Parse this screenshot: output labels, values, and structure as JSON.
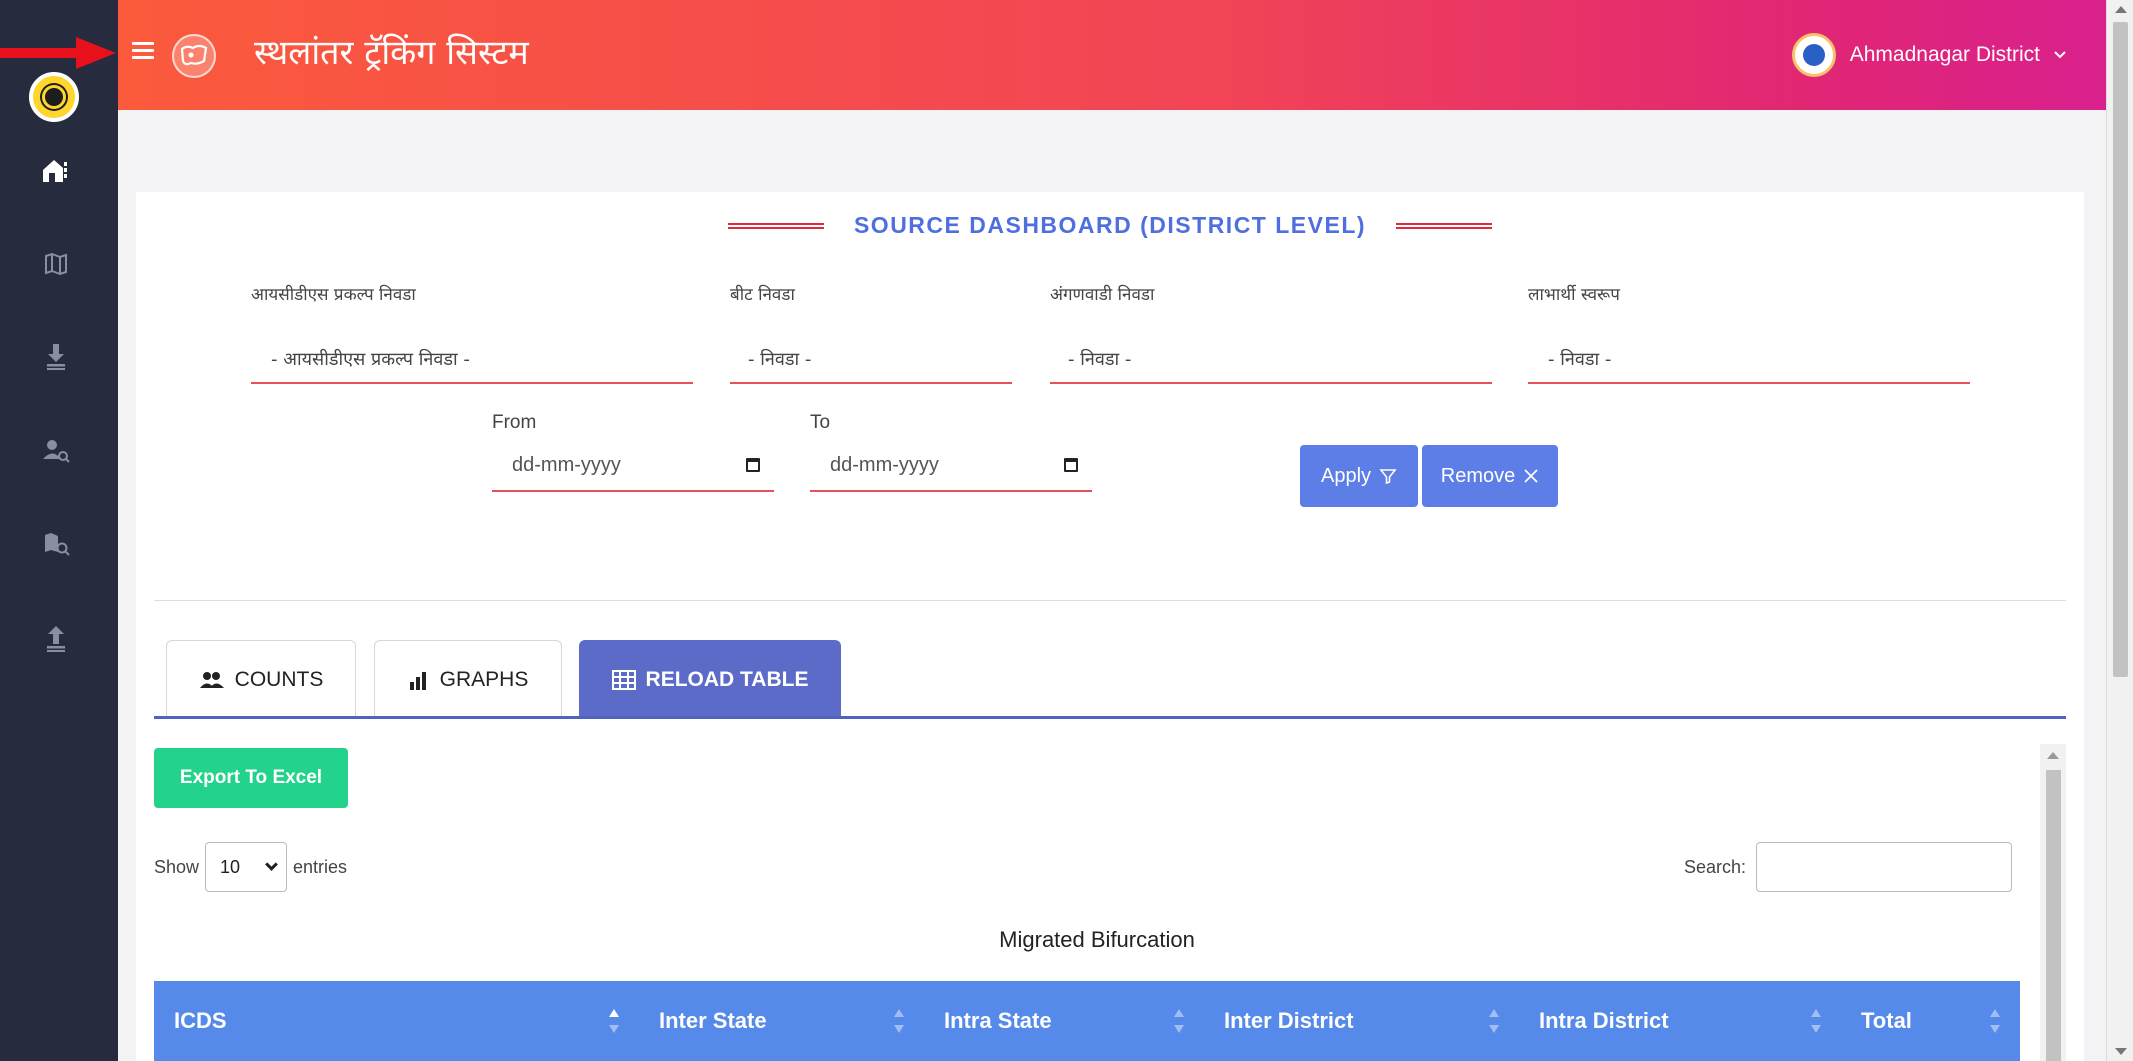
{
  "header": {
    "title": "स्थलांतर ट्रॅकिंग सिस्टम",
    "user_label": "Ahmadnagar District",
    "user_dropdown_icon": "chevron-down-icon"
  },
  "colors": {
    "header_start": "#fb5a3c",
    "header_end": "#d9208d",
    "sidebar": "#262b3d",
    "accent": "#5c7ee6",
    "success": "#23d38c",
    "table_header": "#5589ea",
    "underline": "#e3515d"
  },
  "sidebar": {
    "items": [
      {
        "icon": "home-icon"
      },
      {
        "icon": "map-icon"
      },
      {
        "icon": "download-icon"
      },
      {
        "icon": "user-search-icon"
      },
      {
        "icon": "map-search-icon"
      },
      {
        "icon": "upload-icon"
      }
    ]
  },
  "dashboard": {
    "title": "SOURCE DASHBOARD (DISTRICT LEVEL)",
    "filters": [
      {
        "label": "आयसीडीएस प्रकल्प निवडा",
        "value": "- आयसीडीएस प्रकल्प निवडा -"
      },
      {
        "label": "बीट निवडा",
        "value": "- निवडा -"
      },
      {
        "label": "अंगणवाडी निवडा",
        "value": "- निवडा -"
      },
      {
        "label": "लाभार्थी स्वरूप",
        "value": "- निवडा -"
      }
    ],
    "from_label": "From",
    "to_label": "To",
    "from_placeholder": "dd-mm-yyyy",
    "to_placeholder": "dd-mm-yyyy",
    "apply_label": "Apply",
    "remove_label": "Remove"
  },
  "tabs": [
    {
      "label": "COUNTS",
      "icon": "users-icon",
      "active": false
    },
    {
      "label": "GRAPHS",
      "icon": "bar-chart-icon",
      "active": false
    },
    {
      "label": "RELOAD TABLE",
      "icon": "table-icon",
      "active": true
    }
  ],
  "table": {
    "export_label": "Export To Excel",
    "show_label": "Show",
    "entries_value": "10",
    "entries_label": "entries",
    "search_label": "Search:",
    "search_value": "",
    "caption": "Migrated Bifurcation",
    "columns": [
      "ICDS",
      "Inter State",
      "Intra State",
      "Inter District",
      "Intra District",
      "Total"
    ]
  }
}
